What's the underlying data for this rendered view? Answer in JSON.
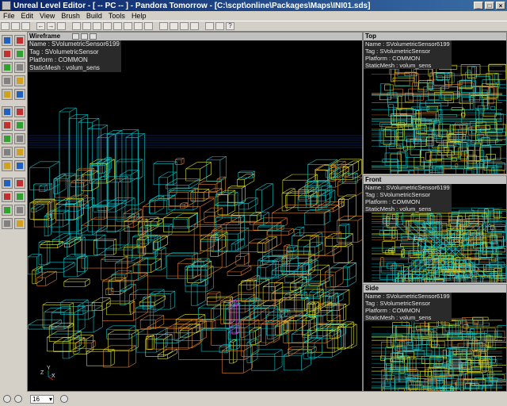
{
  "window": {
    "title": "Unreal Level Editor - [ -- PC -- ] - Pandora Tomorrow - [C:\\scpt\\online\\Packages\\Maps\\INI01.sds]",
    "minimize": "_",
    "maximize": "□",
    "close": "×"
  },
  "menu": [
    "File",
    "Edit",
    "View",
    "Brush",
    "Build",
    "Tools",
    "Help"
  ],
  "viewports": {
    "wireframe": {
      "label": "Wireframe"
    },
    "top": {
      "label": "Top"
    },
    "front": {
      "label": "Front"
    },
    "side": {
      "label": "Side"
    }
  },
  "selection": {
    "name": "Name : SVolumetricSensor6199",
    "tag": "Tag : SVolumetricSensor",
    "platform": "Platform : COMMON",
    "staticmesh": "StaticMesh : volum_sens"
  },
  "axes": {
    "z": "Z",
    "y": "Y",
    "x": "X"
  },
  "status": {
    "grid_value": "16"
  },
  "colors": {
    "cyan": "#11c0c8",
    "yellow": "#e0e030",
    "orange": "#d88030",
    "magenta": "#e040e0",
    "green": "#20c040",
    "blue": "#2244c0"
  }
}
